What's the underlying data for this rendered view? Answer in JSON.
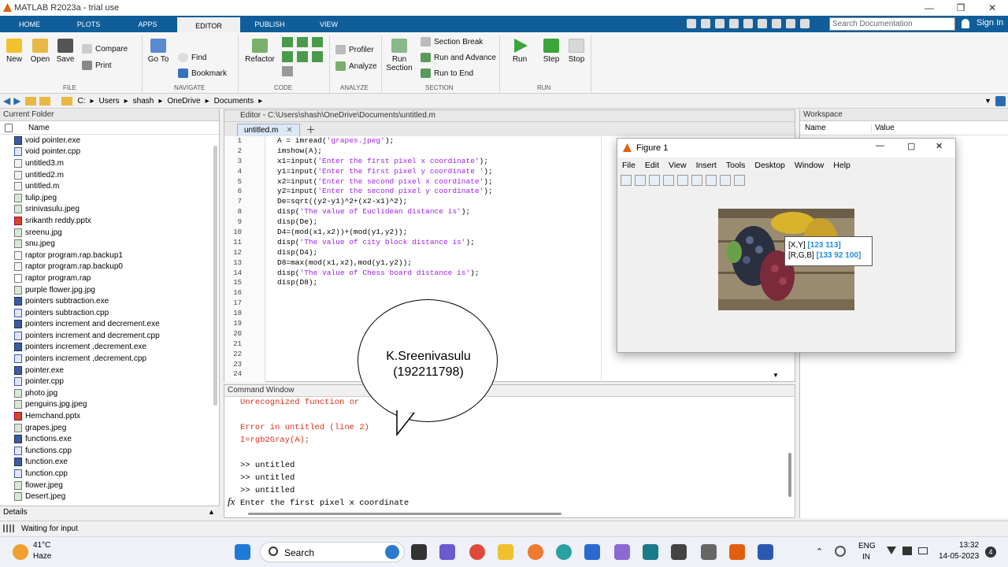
{
  "window": {
    "title": "MATLAB R2023a - trial use",
    "min": "—",
    "max": "❐",
    "close": "✕"
  },
  "tabs": [
    {
      "label": "HOME"
    },
    {
      "label": "PLOTS"
    },
    {
      "label": "APPS"
    },
    {
      "label": "EDITOR"
    },
    {
      "label": "PUBLISH"
    },
    {
      "label": "VIEW"
    }
  ],
  "search_placeholder": "Search Documentation",
  "sign_in": "Sign In",
  "ribbon": {
    "file": {
      "new": "New",
      "open": "Open",
      "save": "Save",
      "compare": "Compare",
      "print": "Print",
      "group": "FILE"
    },
    "navigate": {
      "goto": "Go To",
      "find": "Find",
      "bookmark": "Bookmark",
      "group": "NAVIGATE"
    },
    "code": {
      "refactor": "Refactor",
      "group": "CODE"
    },
    "analyze": {
      "profiler": "Profiler",
      "analyze": "Analyze",
      "group": "ANALYZE"
    },
    "section": {
      "run_section": "Run Section",
      "section_break": "Section Break",
      "run_advance": "Run and Advance",
      "run_end": "Run to End",
      "group": "SECTION"
    },
    "run": {
      "run": "Run",
      "step": "Step",
      "stop": "Stop",
      "group": "RUN"
    }
  },
  "address": {
    "crumbs": [
      "C:",
      "Users",
      "shash",
      "OneDrive",
      "Documents"
    ]
  },
  "current_folder": {
    "title": "Current Folder",
    "col_name": "Name",
    "files": [
      {
        "name": "void pointer.exe",
        "type": "exe"
      },
      {
        "name": "void pointer.cpp",
        "type": "cpp"
      },
      {
        "name": "untitled3.m",
        "type": "m"
      },
      {
        "name": "untitled2.m",
        "type": "m"
      },
      {
        "name": "untitled.m",
        "type": "m"
      },
      {
        "name": "tulip.jpeg",
        "type": "img"
      },
      {
        "name": "srinivasulu.jpeg",
        "type": "img"
      },
      {
        "name": "srikanth reddy.pptx",
        "type": "pp"
      },
      {
        "name": "sreenu.jpg",
        "type": "img"
      },
      {
        "name": "snu.jpeg",
        "type": "img"
      },
      {
        "name": "raptor program.rap.backup1",
        "type": "m"
      },
      {
        "name": "raptor program.rap.backup0",
        "type": "m"
      },
      {
        "name": "raptor program.rap",
        "type": "rap"
      },
      {
        "name": "purple flower.jpg.jpg",
        "type": "img"
      },
      {
        "name": "pointers subtraction.exe",
        "type": "exe"
      },
      {
        "name": "pointers subtraction.cpp",
        "type": "cpp"
      },
      {
        "name": "pointers increment and decrement.exe",
        "type": "exe"
      },
      {
        "name": "pointers increment and decrement.cpp",
        "type": "cpp"
      },
      {
        "name": "pointers increment ,decrement.exe",
        "type": "exe"
      },
      {
        "name": "pointers increment ,decrement.cpp",
        "type": "cpp"
      },
      {
        "name": "pointer.exe",
        "type": "exe"
      },
      {
        "name": "pointer.cpp",
        "type": "cpp"
      },
      {
        "name": "photo.jpg",
        "type": "img"
      },
      {
        "name": "penguins.jpg.jpeg",
        "type": "img"
      },
      {
        "name": "Hemchand.pptx",
        "type": "pp"
      },
      {
        "name": "grapes.jpeg",
        "type": "img"
      },
      {
        "name": "functions.exe",
        "type": "exe"
      },
      {
        "name": "functions.cpp",
        "type": "cpp"
      },
      {
        "name": "function.exe",
        "type": "exe"
      },
      {
        "name": "function.cpp",
        "type": "cpp"
      },
      {
        "name": "flower.jpeg",
        "type": "img"
      },
      {
        "name": "Desert.jpeg",
        "type": "img"
      }
    ],
    "details": "Details"
  },
  "editor": {
    "title": "Editor - C:\\Users\\shash\\OneDrive\\Documents\\untitled.m",
    "tab": "untitled.m",
    "line_numbers": [
      "1",
      "2",
      "3",
      "4",
      "5",
      "6",
      "7",
      "8",
      "9",
      "10",
      "11",
      "12",
      "13",
      "14",
      "15",
      "16",
      "17",
      "18",
      "19",
      "20",
      "21",
      "22",
      "23",
      "24"
    ],
    "lines": [
      {
        "pre": "A = imread(",
        "str": "'grapes.jpeg'",
        "post": ");"
      },
      {
        "pre": "imshow(A);",
        "str": "",
        "post": ""
      },
      {
        "pre": "x1=input(",
        "str": "'Enter the first pixel x coordinate'",
        "post": ");"
      },
      {
        "pre": "y1=input(",
        "str": "'Enter the first pixel y coordinate '",
        "post": ");"
      },
      {
        "pre": "x2=input(",
        "str": "'Enter the second pixel x coordinate'",
        "post": ");"
      },
      {
        "pre": "y2=input(",
        "str": "'Enter the second pixel y coordinate'",
        "post": ");"
      },
      {
        "pre": "De=sqrt((y2-y1)^2+(x2-x1)^2);",
        "str": "",
        "post": ""
      },
      {
        "pre": "disp(",
        "str": "'The value of Euclidean distance is'",
        "post": ");"
      },
      {
        "pre": "disp(De);",
        "str": "",
        "post": ""
      },
      {
        "pre": "D4=(mod(x1,x2))+(mod(y1,y2));",
        "str": "",
        "post": ""
      },
      {
        "pre": "disp(",
        "str": "'The value of city block distance is'",
        "post": ");"
      },
      {
        "pre": "disp(D4);",
        "str": "",
        "post": ""
      },
      {
        "pre": "D8=max(mod(x1,x2),mod(y1,y2));",
        "str": "",
        "post": ""
      },
      {
        "pre": "disp(",
        "str": "'The value of Chess board distance is'",
        "post": ");"
      },
      {
        "pre": "disp(D8);",
        "str": "",
        "post": ""
      }
    ]
  },
  "command_window": {
    "title": "Command Window",
    "lines": [
      {
        "text": "Unrecognized function or",
        "cls": "err"
      },
      {
        "text": "",
        "cls": ""
      },
      {
        "text": "Error in untitled (line 2)",
        "cls": "err"
      },
      {
        "text": "I=rgb2Gray(A);",
        "cls": "err"
      },
      {
        "text": "",
        "cls": ""
      },
      {
        "text": ">> untitled",
        "cls": ""
      },
      {
        "text": ">> untitled",
        "cls": ""
      },
      {
        "text": ">> untitled",
        "cls": ""
      },
      {
        "text": "Enter the first pixel x coordinate",
        "cls": ""
      }
    ],
    "fx": "fx"
  },
  "workspace": {
    "title": "Workspace",
    "col_name": "Name",
    "col_value": "Value"
  },
  "figure": {
    "title": "Figure 1",
    "menu": [
      "File",
      "Edit",
      "View",
      "Insert",
      "Tools",
      "Desktop",
      "Window",
      "Help"
    ],
    "tooltip": {
      "xy_label": "[X,Y]",
      "xy_value": "[123 113]",
      "rgb_label": "[R,G,B]",
      "rgb_value": "[133 92 100]"
    }
  },
  "bubble": {
    "name": "K.Sreenivasulu",
    "id": "(192211798)"
  },
  "status": "Waiting for input",
  "taskbar": {
    "temp": "41°C",
    "weather": "Haze",
    "search": "Search",
    "lang1": "ENG",
    "lang2": "IN",
    "time": "13:32",
    "date": "14-05-2023",
    "badge": "4"
  }
}
